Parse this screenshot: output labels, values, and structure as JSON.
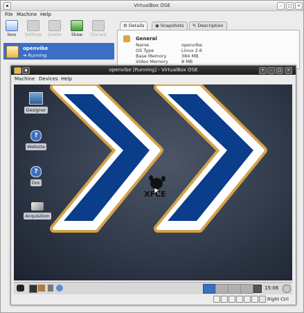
{
  "outer_window": {
    "title": "VirtualBox OSE",
    "menu": [
      "File",
      "Machine",
      "Help"
    ],
    "toolbar": [
      {
        "label": "New",
        "enabled": true,
        "icon": "new-vm-icon"
      },
      {
        "label": "Settings",
        "enabled": false,
        "icon": "settings-icon"
      },
      {
        "label": "Delete",
        "enabled": false,
        "icon": "delete-icon"
      },
      {
        "label": "Show",
        "enabled": true,
        "icon": "show-icon"
      },
      {
        "label": "Discard",
        "enabled": false,
        "icon": "discard-icon"
      }
    ],
    "vm": {
      "name": "openvibe",
      "state": "Running"
    },
    "tabs": [
      "Details",
      "Snapshots",
      "Description"
    ],
    "details": {
      "heading": "General",
      "rows": [
        {
          "label": "Name",
          "value": "openvibe"
        },
        {
          "label": "OS Type",
          "value": "Linux 2.6"
        },
        {
          "label": "Base Memory",
          "value": "384 MB"
        },
        {
          "label": "Video Memory",
          "value": "8 MB"
        }
      ]
    }
  },
  "inner_window": {
    "title": "openvibe [Running] - VirtualBox OSE",
    "menu": [
      "Machine",
      "Devices",
      "Help"
    ],
    "desktop_icons": [
      {
        "label": "Designer"
      },
      {
        "label": "Website"
      },
      {
        "label": "Doc"
      },
      {
        "label": "Acquisition"
      }
    ],
    "xfce_logo": "XFCE",
    "clock": "15:06",
    "host_key": "Right Ctrl"
  },
  "colors": {
    "selection": "#3b6ec4",
    "chevron_fill": "#0a3d8a",
    "chevron_border": "#ffffff",
    "chevron_outline": "#d4a24a",
    "desktop": "#313a4a"
  }
}
